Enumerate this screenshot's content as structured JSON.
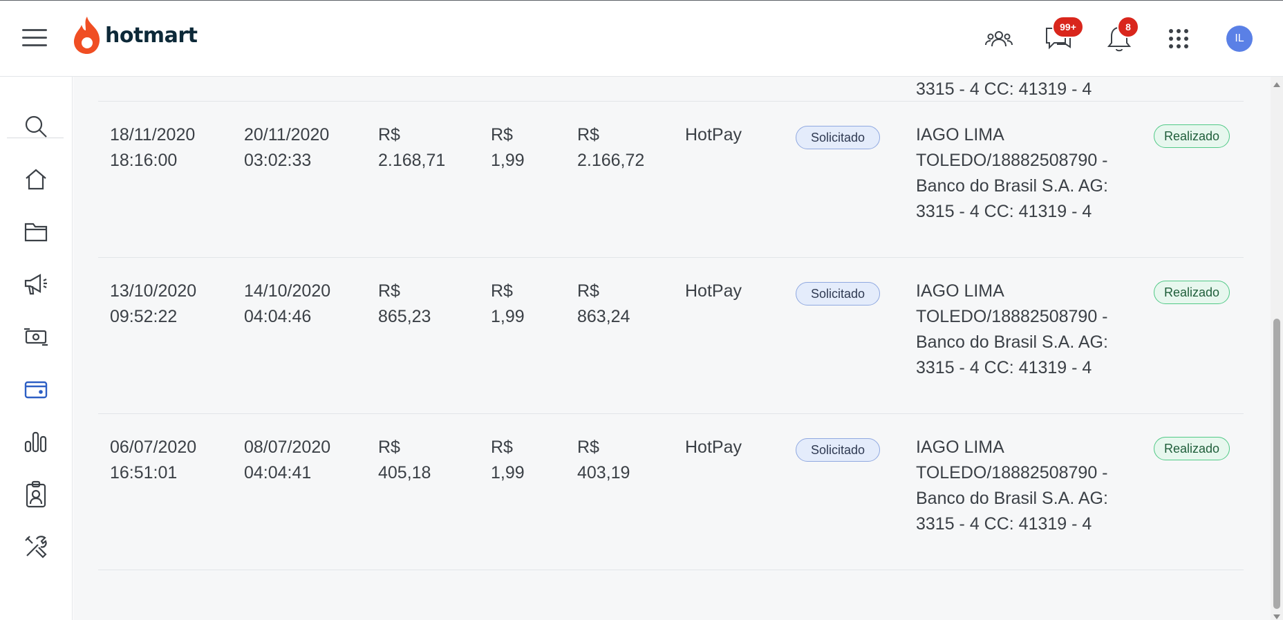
{
  "app": {
    "logo_text": "hotmart",
    "brand_color": "#f04e23"
  },
  "header": {
    "icons": [
      "menu-icon",
      "users-icon",
      "chat-icon",
      "bell-icon",
      "apps-grid-icon"
    ],
    "chat_badge": "99+",
    "notifications_badge": "8",
    "avatar_initials": "IL"
  },
  "sidebar": {
    "items": [
      {
        "name": "search",
        "icon": "search-icon"
      },
      {
        "name": "home",
        "icon": "home-icon"
      },
      {
        "name": "products",
        "icon": "folder-icon"
      },
      {
        "name": "marketing",
        "icon": "megaphone-icon"
      },
      {
        "name": "sales",
        "icon": "money-icon"
      },
      {
        "name": "wallet",
        "icon": "wallet-icon",
        "active": true
      },
      {
        "name": "analytics",
        "icon": "bar-chart-icon"
      },
      {
        "name": "affiliates",
        "icon": "clipboard-user-icon"
      },
      {
        "name": "tools",
        "icon": "tools-icon"
      }
    ],
    "active_color": "#2d5fc4"
  },
  "partial_row": {
    "bank_line": "3315 - 4 CC: 41319 - 4"
  },
  "rows": [
    {
      "request_date": "18/11/2020",
      "request_time": "18:16:00",
      "transfer_date": "20/11/2020",
      "transfer_time": "03:02:33",
      "amount_currency": "R$",
      "amount": "2.168,71",
      "fee_currency": "R$",
      "fee": "1,99",
      "net_currency": "R$",
      "net": "2.166,72",
      "method": "HotPay",
      "request_status": "Solicitado",
      "bank_lines": [
        "IAGO LIMA",
        "TOLEDO/18882508790 -",
        "Banco do Brasil S.A. AG:",
        "3315 - 4 CC: 41319 - 4"
      ],
      "status": "Realizado"
    },
    {
      "request_date": "13/10/2020",
      "request_time": "09:52:22",
      "transfer_date": "14/10/2020",
      "transfer_time": "04:04:46",
      "amount_currency": "R$",
      "amount": "865,23",
      "fee_currency": "R$",
      "fee": "1,99",
      "net_currency": "R$",
      "net": "863,24",
      "method": "HotPay",
      "request_status": "Solicitado",
      "bank_lines": [
        "IAGO LIMA",
        "TOLEDO/18882508790 -",
        "Banco do Brasil S.A. AG:",
        "3315 - 4 CC: 41319 - 4"
      ],
      "status": "Realizado"
    },
    {
      "request_date": "06/07/2020",
      "request_time": "16:51:01",
      "transfer_date": "08/07/2020",
      "transfer_time": "04:04:41",
      "amount_currency": "R$",
      "amount": "405,18",
      "fee_currency": "R$",
      "fee": "1,99",
      "net_currency": "R$",
      "net": "403,19",
      "method": "HotPay",
      "request_status": "Solicitado",
      "bank_lines": [
        "IAGO LIMA",
        "TOLEDO/18882508790 -",
        "Banco do Brasil S.A. AG:",
        "3315 - 4 CC: 41319 - 4"
      ],
      "status": "Realizado"
    }
  ]
}
